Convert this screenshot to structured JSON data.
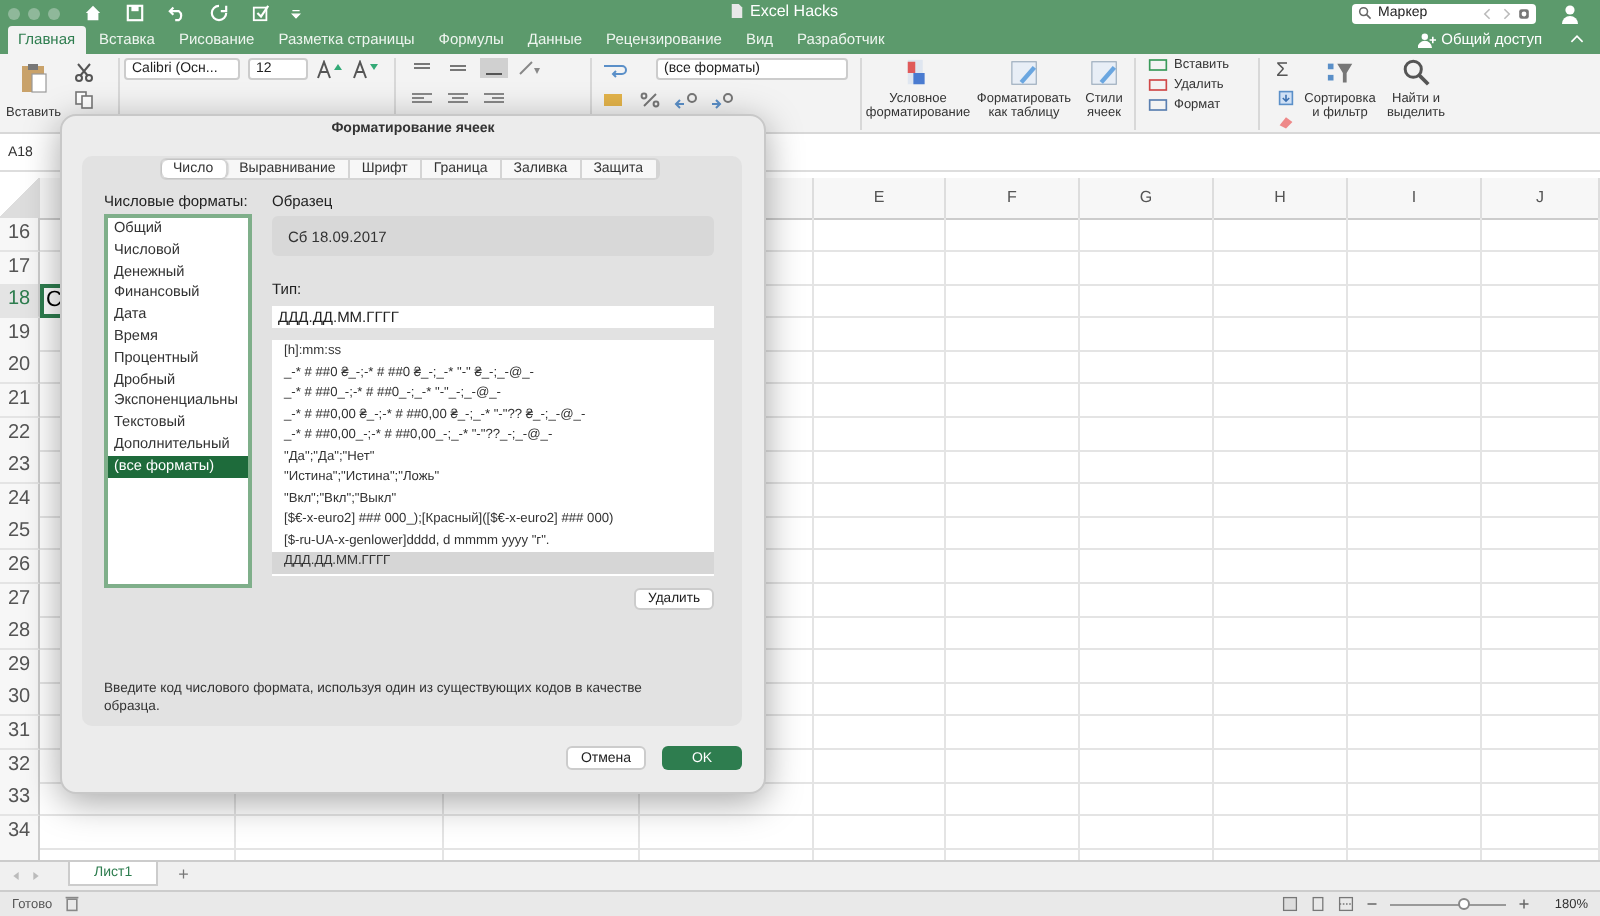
{
  "window": {
    "title": "Excel Hacks"
  },
  "search": {
    "value": "Маркер"
  },
  "ribbon_tabs": [
    {
      "label": "Главная",
      "selected": true
    },
    {
      "label": "Вставка",
      "selected": false
    },
    {
      "label": "Рисование",
      "selected": false
    },
    {
      "label": "Разметка страницы",
      "selected": false
    },
    {
      "label": "Формулы",
      "selected": false
    },
    {
      "label": "Данные",
      "selected": false
    },
    {
      "label": "Рецензирование",
      "selected": false
    },
    {
      "label": "Вид",
      "selected": false
    },
    {
      "label": "Разработчик",
      "selected": false
    }
  ],
  "share": {
    "label": "Общий доступ"
  },
  "ribbon": {
    "paste": "Вставить",
    "font": "Calibri (Осн...",
    "size": "12",
    "number_format": "(все форматы)",
    "styles": [
      "Условное форматирование",
      "Форматировать как таблицу",
      "Стили ячеек"
    ],
    "cells": [
      "Вставить",
      "Удалить",
      "Формат"
    ],
    "autosum": "Σ",
    "editing": [
      "Сортировка и фильтр",
      "Найти и выделить"
    ]
  },
  "name_box": "A18",
  "sheet": {
    "columns": [
      "E",
      "F",
      "G",
      "H",
      "I",
      "J"
    ],
    "active_cell_text": "С",
    "rows": [
      {
        "label": "16",
        "selected": false
      },
      {
        "label": "17",
        "selected": false
      },
      {
        "label": "18",
        "selected": true
      },
      {
        "label": "19",
        "selected": false
      },
      {
        "label": "20",
        "selected": false
      },
      {
        "label": "21",
        "selected": false
      },
      {
        "label": "22",
        "selected": false
      },
      {
        "label": "23",
        "selected": false
      },
      {
        "label": "24",
        "selected": false
      },
      {
        "label": "25",
        "selected": false
      },
      {
        "label": "26",
        "selected": false
      },
      {
        "label": "27",
        "selected": false
      },
      {
        "label": "28",
        "selected": false
      },
      {
        "label": "29",
        "selected": false
      },
      {
        "label": "30",
        "selected": false
      },
      {
        "label": "31",
        "selected": false
      },
      {
        "label": "32",
        "selected": false
      },
      {
        "label": "33",
        "selected": false
      },
      {
        "label": "34",
        "selected": false
      }
    ]
  },
  "dialog": {
    "title": "Форматирование ячеек",
    "tabs": [
      {
        "label": "Число",
        "selected": true
      },
      {
        "label": "Выравнивание",
        "selected": false
      },
      {
        "label": "Шрифт",
        "selected": false
      },
      {
        "label": "Граница",
        "selected": false
      },
      {
        "label": "Заливка",
        "selected": false
      },
      {
        "label": "Защита",
        "selected": false
      }
    ],
    "categories_label": "Числовые форматы:",
    "categories": [
      {
        "label": "Общий",
        "selected": false
      },
      {
        "label": "Числовой",
        "selected": false
      },
      {
        "label": "Денежный",
        "selected": false
      },
      {
        "label": "Финансовый",
        "selected": false
      },
      {
        "label": "Дата",
        "selected": false
      },
      {
        "label": "Время",
        "selected": false
      },
      {
        "label": "Процентный",
        "selected": false
      },
      {
        "label": "Дробный",
        "selected": false
      },
      {
        "label": "Экспоненциальны",
        "selected": false
      },
      {
        "label": "Текстовый",
        "selected": false
      },
      {
        "label": "Дополнительный",
        "selected": false
      },
      {
        "label": "(все форматы)",
        "selected": true
      }
    ],
    "sample_label": "Образец",
    "sample": "Сб 18.09.2017",
    "type_label": "Тип:",
    "type_value": "ДДД.ДД.ММ.ГГГГ",
    "codes": [
      {
        "label": "[h]:mm:ss",
        "selected": false
      },
      {
        "label": "_-* # ##0 ₴_-;-* # ##0 ₴_-;_-* \"-\" ₴_-;_-@_-",
        "selected": false
      },
      {
        "label": "_-* # ##0_-;-* # ##0_-;_-* \"-\"_-;_-@_-",
        "selected": false
      },
      {
        "label": "_-* # ##0,00 ₴_-;-* # ##0,00 ₴_-;_-* \"-\"?? ₴_-;_-@_-",
        "selected": false
      },
      {
        "label": "_-* # ##0,00_-;-* # ##0,00_-;_-* \"-\"??_-;_-@_-",
        "selected": false
      },
      {
        "label": "\"Да\";\"Да\";\"Нет\"",
        "selected": false
      },
      {
        "label": "\"Истина\";\"Истина\";\"Ложь\"",
        "selected": false
      },
      {
        "label": "\"Вкл\";\"Вкл\";\"Выкл\"",
        "selected": false
      },
      {
        "label": "[$€-x-euro2] ### 000_);[Красный]([$€-x-euro2] ### 000)",
        "selected": false
      },
      {
        "label": "[$-ru-UA-x-genlower]dddd, d mmmm yyyy \"г\".",
        "selected": false
      },
      {
        "label": "ДДД.ДД.ММ.ГГГГ",
        "selected": true
      }
    ],
    "delete_button": "Удалить",
    "help": "Введите код числового формата, используя один из существующих кодов в качестве образца.",
    "cancel": "Отмена",
    "ok": "OK"
  },
  "sheet_tabs": [
    {
      "label": "Лист1",
      "selected": true
    }
  ],
  "add_sheet": "+",
  "status_bar": {
    "status": "Готово",
    "zoom": "180%",
    "level": 0.63
  }
}
